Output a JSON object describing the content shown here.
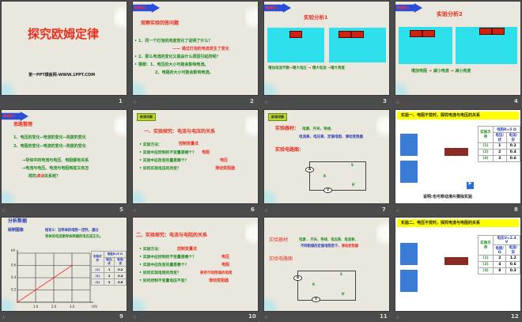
{
  "slides": [
    {
      "num": "1",
      "title": "探究欧姆定律",
      "footer": "第一PPT模板网-WWW.1PPT.COM"
    },
    {
      "num": "2",
      "tag": "新课导入",
      "heading": "观察实验回答问题",
      "lines": [
        "• 1、同一个灯泡的亮度变化了说明了什么？",
        "—— 通过灯泡的电流发生了变化",
        "• 2、那么电流的变化又是由什么原因引起的呢？",
        "• 猜想：1、电压的大小可能会影响电流。",
        "2、电阻的大小可能会影响电流。"
      ]
    },
    {
      "num": "3",
      "tag": "新课导入",
      "heading": "实验分析1",
      "caption": [
        "增加电池节数",
        "增大电压",
        "增大电流",
        "增大亮度"
      ]
    },
    {
      "num": "4",
      "tag": "新课导入",
      "heading": "实验分析2",
      "caption": [
        "增加电阻",
        "减小电流",
        "减小亮度"
      ]
    },
    {
      "num": "5",
      "tag": "新课导入",
      "heading": "思路整理",
      "lines": [
        "1、电压的变化--电流的变化--亮度的变化",
        "2、电阻的变化--电流的变化--亮度的变化",
        "→导体中的电流与电压、电阻都有关系",
        "→电流与电压、电流与电阻到底又有怎",
        "样的",
        "具体",
        "关系呢？"
      ]
    },
    {
      "num": "6",
      "tag": "新课讲解",
      "heading": "一、实验探究：电流与电压的关系",
      "qs": [
        "• 实验方法：",
        "• 实验中应控制的不变量是哪个？",
        "• 实验中应改变的量是哪个？",
        "• 如何实现电压的改变？"
      ],
      "ans": [
        "控制变量法",
        "电阻",
        "电压",
        "滑动变阻器"
      ]
    },
    {
      "num": "7",
      "tag": "新课讲解",
      "label1": "实验器材：",
      "mat1": "电源、开关、导线、",
      "mat2": "电流表、电压表、定值电阻、滑动变阻器",
      "label2": "实验电路图：",
      "sym": {
        "A": "A",
        "V": "V",
        "R": "R",
        "Rp": "R'",
        "S": "S"
      }
    },
    {
      "num": "8",
      "banner": "实验一、电阻不变时，探究电流与电压的关系",
      "table": {
        "h1": "实验次序",
        "h2": "电阻R=",
        "rval": "5 Ω",
        "c1": "电压/伏",
        "c2": "电流/安",
        "rows": [
          [
            "(1)",
            "1",
            "0.2"
          ],
          [
            "(2)",
            "2",
            "0.4"
          ],
          [
            "(3)",
            "3",
            "0.6"
          ]
        ]
      },
      "note": "说明:也可移动滑片模拟实验"
    },
    {
      "num": "9",
      "h1": "分析数据",
      "h2": "绘制图象",
      "concl1": "结论1：当导体的电阻一定时，通过",
      "concl2": "导体的电流跟导体两端的电压成正比。",
      "chart_data": {
        "type": "line",
        "xlabel": "U/V",
        "ylabel": "I/A",
        "xticks": [
          "1.0",
          "2.0",
          "3.0"
        ],
        "yticks": [
          "0.2",
          "0.4",
          "0.6"
        ],
        "xlim": [
          0,
          4
        ],
        "ylim": [
          0,
          0.8
        ],
        "x": [
          0,
          1,
          2,
          3
        ],
        "y": [
          0,
          0.2,
          0.4,
          0.6
        ]
      },
      "table": {
        "h1": "实验次序",
        "h2": "电阻R=5 Ω",
        "c1": "电压/伏",
        "c2": "电流/安",
        "rows": [
          [
            "(1)",
            "1",
            "0.2"
          ],
          [
            "(2)",
            "2",
            "0.4"
          ],
          [
            "(3)",
            "3",
            "0.6"
          ]
        ]
      }
    },
    {
      "num": "10",
      "heading": "二、实验探究：电流与电阻的关系",
      "qs": [
        "• 实验方法：",
        "• 实验中应控制的不变量是哪个？",
        "• 实验中应改变的量是哪个？",
        "• 如何实现电阻的改变？",
        "• 如何控制不变量电压不变？"
      ],
      "ans": [
        "控制变量法",
        "电压",
        "电阻",
        "换用不同阻值的电阻",
        "滑动变阻器"
      ]
    },
    {
      "num": "11",
      "label1": "实验器材",
      "mat1": "电源 、开关、导线、电压表、电流表、",
      "mat2": "不同阻值的定值电阻若干、",
      "mat3": "滑动变阻器",
      "label2": "实验电路图",
      "sym": {
        "A": "A",
        "V": "V",
        "R": "R",
        "Rp": "R'",
        "S": "S"
      }
    },
    {
      "num": "12",
      "banner": "实验二、电压不变时，探究电流与电阻的关系",
      "table": {
        "h1": "实验次序",
        "h2": "电压U=",
        "rval": "2.4 V",
        "c1": "电阻/Ω",
        "c2": "电流/安",
        "rows": [
          [
            "(1)",
            "2",
            "1.2"
          ],
          [
            "(2)",
            "4",
            "0.6"
          ],
          [
            "(3)",
            "8",
            "0.3"
          ]
        ]
      }
    }
  ],
  "transition_icon": "star-icon"
}
